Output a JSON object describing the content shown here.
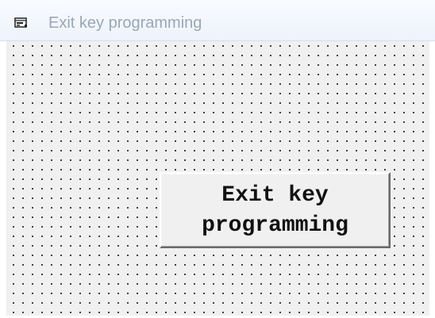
{
  "window": {
    "title": "Exit key programming",
    "icon": "form-icon"
  },
  "button": {
    "label": "Exit key\nprogramming"
  },
  "colors": {
    "title_text": "#9aa7b4",
    "client_background": "#f0f0f0",
    "grid_dot": "#1a1a1a",
    "button_face": "#f0f0f0"
  }
}
